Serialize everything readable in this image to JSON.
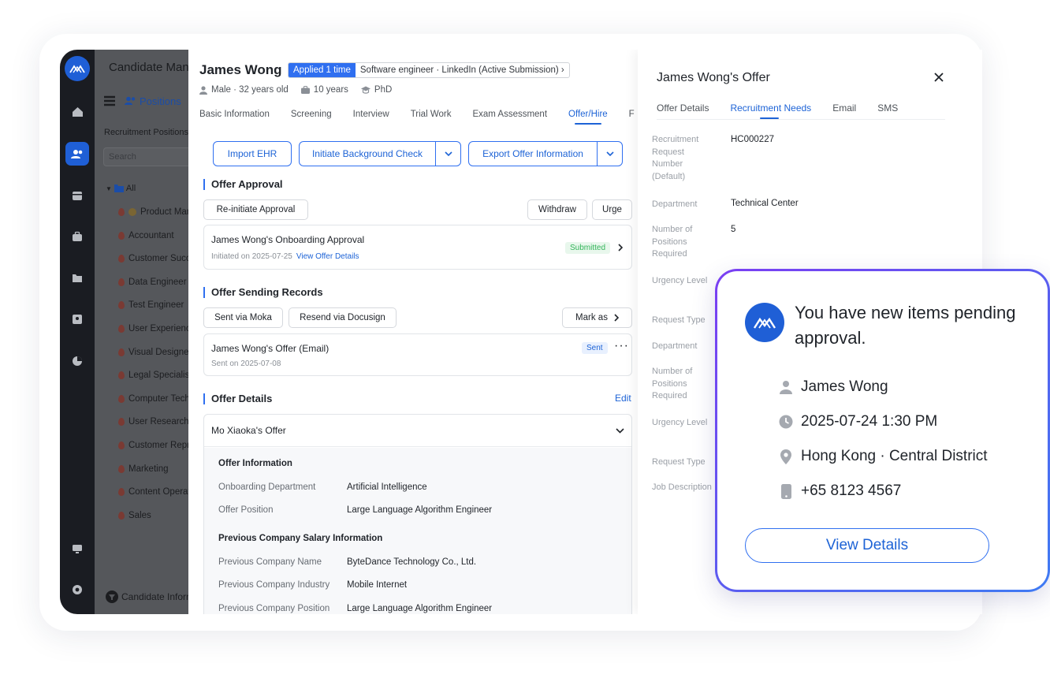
{
  "nav": {
    "title": "Candidate Management",
    "subnav_label": "Positions",
    "section_label": "Recruitment Positions",
    "search_placeholder": "Search",
    "all_label": "All",
    "items": [
      "Product Manager",
      "Accountant",
      "Customer Success",
      "Data Engineer",
      "Test Engineer",
      "User Experience",
      "Visual Designer",
      "Legal Specialist",
      "Computer Technician",
      "User Researcher",
      "Customer Representative",
      "Marketing",
      "Content Operations",
      "Sales"
    ],
    "footer_label": "Candidate Information"
  },
  "candidate": {
    "name": "James Wong",
    "applied_badge": "Applied 1 time",
    "source": "Software engineer · LinkedIn (Active Submission)",
    "gender_age": "Male · 32 years old",
    "experience": "10 years",
    "education": "PhD"
  },
  "tabs": [
    "Basic Information",
    "Screening",
    "Interview",
    "Trial Work",
    "Exam Assessment",
    "Offer/Hire",
    "F"
  ],
  "actions": {
    "import": "Import EHR",
    "background": "Initiate Background Check",
    "export": "Export Offer Information"
  },
  "approval": {
    "heading": "Offer Approval",
    "reinitiate": "Re-initiate Approval",
    "withdraw": "Withdraw",
    "urge": "Urge",
    "card_title": "James Wong's Onboarding Approval",
    "card_sub": "Initiated on 2025-07-25",
    "card_link": "View Offer Details",
    "status": "Submitted"
  },
  "sending": {
    "heading": "Offer Sending Records",
    "moka": "Sent via Moka",
    "docusign": "Resend via Docusign",
    "mark": "Mark as",
    "card_title": "James Wong's Offer (Email)",
    "card_sub": "Sent on 2025-07-08",
    "status": "Sent"
  },
  "details": {
    "heading": "Offer Details",
    "edit": "Edit",
    "offer_title": "Mo Xiaoka's Offer",
    "group1": "Offer Information",
    "dept_label": "Onboarding Department",
    "dept_value": "Artificial Intelligence",
    "pos_label": "Offer Position",
    "pos_value": "Large Language Algorithm Engineer",
    "group2": "Previous Company Salary Information",
    "co_label": "Previous Company Name",
    "co_value": "ByteDance Technology Co., Ltd.",
    "ind_label": "Previous Company Industry",
    "ind_value": "Mobile Internet",
    "ppos_label": "Previous Company Position",
    "ppos_value": "Large Language Algorithm Engineer"
  },
  "offer_panel": {
    "title": "James Wong's Offer",
    "tabs": [
      "Offer Details",
      "Recruitment Needs",
      "Email",
      "SMS"
    ],
    "f1_label": "Recruitment Request Number (Default)",
    "f1_value": "HC000227",
    "f2_label": "Department",
    "f2_value": "Technical Center",
    "f3_label": "Number of Positions Required",
    "f3_value": "5",
    "f4_label": "Urgency Level",
    "f5_label": "Request Type",
    "f6_label": "Department",
    "f7_label": "Number of Positions Required",
    "f8_label": "Urgency Level",
    "f9_label": "Request Type",
    "f10_label": "Job Description"
  },
  "notification": {
    "title": "You have new items pending approval.",
    "person": "James Wong",
    "datetime": "2025-07-24 1:30 PM",
    "location": "Hong Kong · Central District",
    "phone": "+65 8123 4567",
    "button": "View Details"
  },
  "colors": {
    "brand": "#1f5fd6",
    "accent": "#2f6ff0",
    "success": "#33b55a"
  }
}
